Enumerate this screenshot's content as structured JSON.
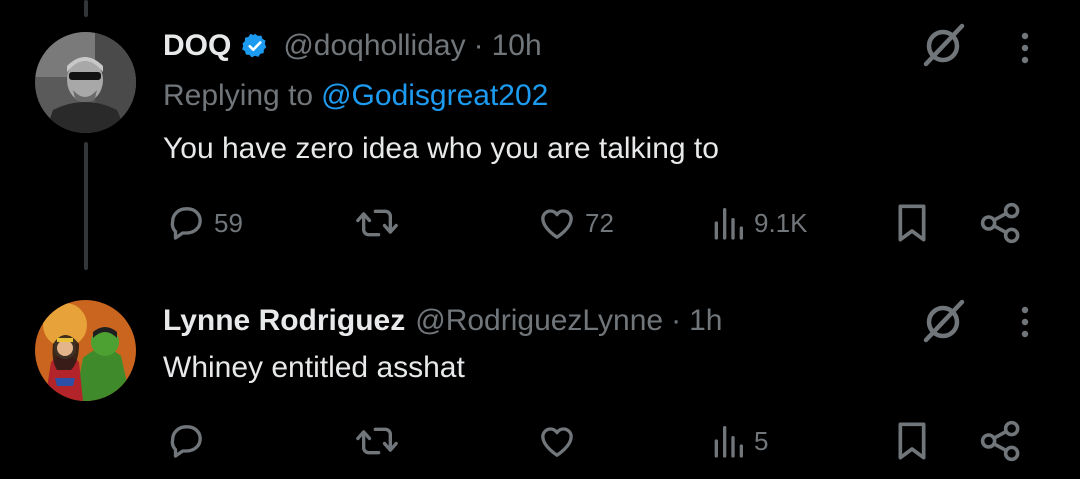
{
  "tweets": [
    {
      "display_name": "DOQ",
      "verified": true,
      "handle": "@doqholliday",
      "separator": "·",
      "time": "10h",
      "replying_prefix": "Replying to",
      "replying_to": "@Godisgreat202",
      "text": "You have zero idea who you are talking to",
      "actions": {
        "replies": "59",
        "retweets": "",
        "likes": "72",
        "views": "9.1K"
      }
    },
    {
      "display_name": "Lynne Rodriguez",
      "verified": false,
      "handle": "@RodriguezLynne",
      "separator": "·",
      "time": "1h",
      "text": "Whiney entitled asshat",
      "actions": {
        "replies": "",
        "retweets": "",
        "likes": "",
        "views": "5"
      }
    }
  ],
  "colors": {
    "background": "#000000",
    "primary_text": "#e7e9ea",
    "secondary_text": "#71767b",
    "accent_blue": "#1d9bf0",
    "thread_line": "#333639"
  },
  "icons": {
    "reply": "reply-bubble-icon",
    "retweet": "retweet-icon",
    "like": "heart-icon",
    "views": "views-bar-chart-icon",
    "bookmark": "bookmark-icon",
    "share": "share-icon",
    "grok": "grok-icon",
    "more": "more-vertical-icon",
    "verified": "verified-badge-icon"
  }
}
